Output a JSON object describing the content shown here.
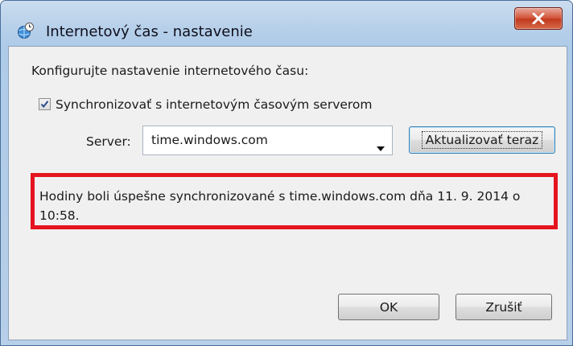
{
  "window": {
    "title": "Internetový čas - nastavenie"
  },
  "dialog": {
    "heading": "Konfigurujte nastavenie internetového času:",
    "sync_checkbox": {
      "checked": true,
      "label": "Synchronizovať s internetovým časovým serverom"
    },
    "server": {
      "label": "Server:",
      "value": "time.windows.com"
    },
    "update_button": "Aktualizovať teraz",
    "status_message": "Hodiny boli úspešne synchronizované s time.windows.com dňa 11. 9. 2014 o 10:58.",
    "ok_button": "OK",
    "cancel_button": "Zrušiť"
  },
  "icons": {
    "app": "clock-globe-icon",
    "close": "close-icon",
    "checkmark": "checkmark-icon",
    "dropdown": "chevron-down-icon"
  },
  "colors": {
    "highlight": "#e5141f",
    "close_button": "#c23a1f",
    "title_bar": "#b9d1ea"
  }
}
